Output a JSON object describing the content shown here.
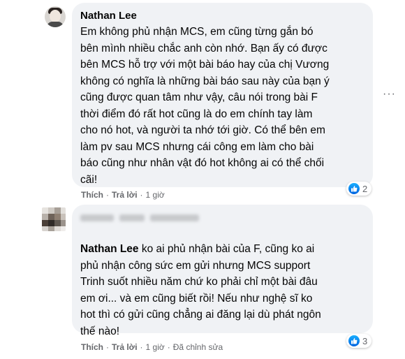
{
  "comment1": {
    "author": "Nathan Lee",
    "text": "Em không phủ nhận MCS, em cũng từng gắn bó\nbên mình nhiều chắc anh còn nhớ. Bạn ấy có được\nbên MCS hỗ trợ với một bài báo hay của chị Vương\nkhông có nghĩa là những bài báo sau này của bạn ý\ncũng được quan tâm như vậy, câu nói trong bài F\nthời điểm đó rất hot cũng là do em chính tay làm\ncho nó hot, và người ta nhớ tới giờ. Có thể bên em\nlàm pv sau MCS nhưng cái công em làm cho bài\nbáo cũng như nhân vật đó hot không ai có thể chối\ncãi!",
    "like_label": "Thích",
    "reply_label": "Trả lời",
    "time": "1 giờ",
    "reaction_count": "2"
  },
  "comment2": {
    "mention": "Nathan Lee",
    "text": " ko ai phủ nhận bài của F, cũng ko ai\nphủ nhận công sức em gửi nhưng MCS support\nTrinh suốt nhiều năm chứ ko phải chỉ một bài đâu\nem ơi... và em cũng biết rồi! Nếu như nghệ sĩ ko\nhot thì có gửi cũng chẳng ai đăng lại dù phát ngôn\nthế nào!",
    "like_label": "Thích",
    "reply_label": "Trả lời",
    "time": "1 giờ",
    "edited_label": "Đã chỉnh sửa",
    "reaction_count": "3"
  },
  "menu": {
    "more_icon": "more-horizontal-icon",
    "symbol": "···"
  },
  "colors": {
    "bubble": "#f0f2f5",
    "secondary_text": "#65676b",
    "like_blue": "#0062df"
  }
}
